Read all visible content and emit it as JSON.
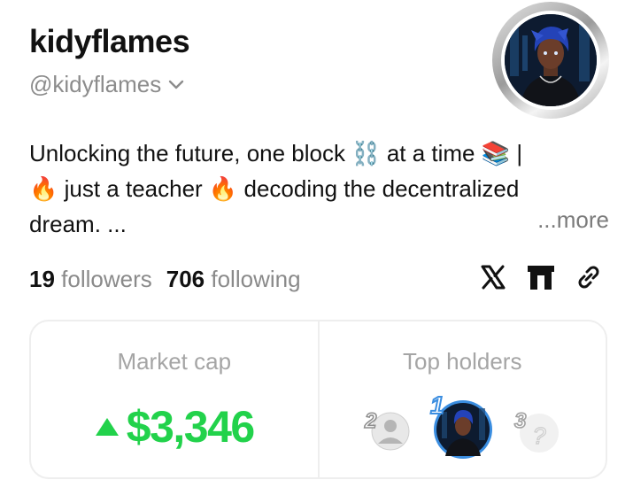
{
  "profile": {
    "display_name": "kidyflames",
    "handle": "@kidyflames",
    "avatar": "avatar-image",
    "bio_lines": [
      "Unlocking the future, one block ⛓️ at a time 📚 |",
      "🔥 just a teacher 🔥 decoding the decentralized",
      "dream. ..."
    ],
    "more_label": "...more"
  },
  "stats": {
    "followers_count": "19",
    "followers_label": "followers",
    "following_count": "706",
    "following_label": "following"
  },
  "socials": [
    "x-icon",
    "gate-icon",
    "link-icon"
  ],
  "market": {
    "title": "Market cap",
    "value": "$3,346",
    "trend": "up",
    "color": "#22d24b"
  },
  "holders": {
    "title": "Top holders",
    "ranks": [
      "1",
      "2",
      "3"
    ]
  }
}
